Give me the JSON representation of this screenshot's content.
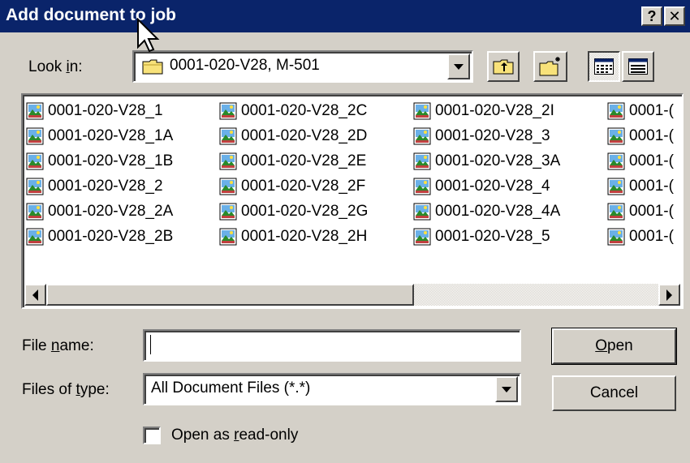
{
  "window": {
    "title": "Add document to job",
    "help_label": "?",
    "close_label": "✕"
  },
  "look_in": {
    "label_pre": "Look ",
    "label_accel": "i",
    "label_post": "n:",
    "value": "0001-020-V28, M-501"
  },
  "toolbar": {
    "up_folder": "up-one-level",
    "new_folder": "create-new-folder",
    "list_view": "list",
    "details_view": "details"
  },
  "files": [
    "0001-020-V28_1",
    "0001-020-V28_1A",
    "0001-020-V28_1B",
    "0001-020-V28_2",
    "0001-020-V28_2A",
    "0001-020-V28_2B",
    "0001-020-V28_2C",
    "0001-020-V28_2D",
    "0001-020-V28_2E",
    "0001-020-V28_2F",
    "0001-020-V28_2G",
    "0001-020-V28_2H",
    "0001-020-V28_2I",
    "0001-020-V28_3",
    "0001-020-V28_3A",
    "0001-020-V28_4",
    "0001-020-V28_4A",
    "0001-020-V28_5",
    "0001-(",
    "0001-(",
    "0001-(",
    "0001-(",
    "0001-(",
    "0001-("
  ],
  "file_name": {
    "label_pre": "File ",
    "label_accel": "n",
    "label_post": "ame:",
    "value": ""
  },
  "file_type": {
    "label_pre": "Files of ",
    "label_accel": "t",
    "label_post": "ype:",
    "value": "All Document Files (*.*)"
  },
  "buttons": {
    "open_accel": "O",
    "open_rest": "pen",
    "cancel": "Cancel"
  },
  "read_only": {
    "label_pre": "Open as ",
    "label_accel": "r",
    "label_post": "ead-only",
    "checked": false
  },
  "colors": {
    "titlebar": "#0a246a",
    "face": "#d4d0c8"
  }
}
